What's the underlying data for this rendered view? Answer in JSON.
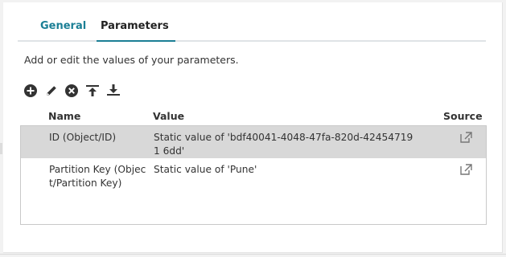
{
  "tabs": [
    {
      "label": "General"
    },
    {
      "label": "Parameters"
    }
  ],
  "description": "Add or edit the values of your parameters.",
  "toolbar": {
    "icons": [
      "add-icon",
      "edit-icon",
      "remove-icon",
      "move-to-top-icon",
      "move-to-bottom-icon"
    ]
  },
  "columns": {
    "name": "Name",
    "value": "Value",
    "source": "Source"
  },
  "rows": [
    {
      "name": "ID (Object/ID)",
      "value": "Static value of 'bdf40041-4048-47fa-820d-424547191 6dd'",
      "source_icon": "external-link-icon",
      "selected": true
    },
    {
      "name": "Partition Key (Object/Partition Key)",
      "value": "Static value of 'Pune'",
      "source_icon": "external-link-icon",
      "selected": false
    }
  ],
  "colors": {
    "accent": "#1b7f95",
    "selected_row": "#d8d8d8",
    "icon": "#333333"
  }
}
